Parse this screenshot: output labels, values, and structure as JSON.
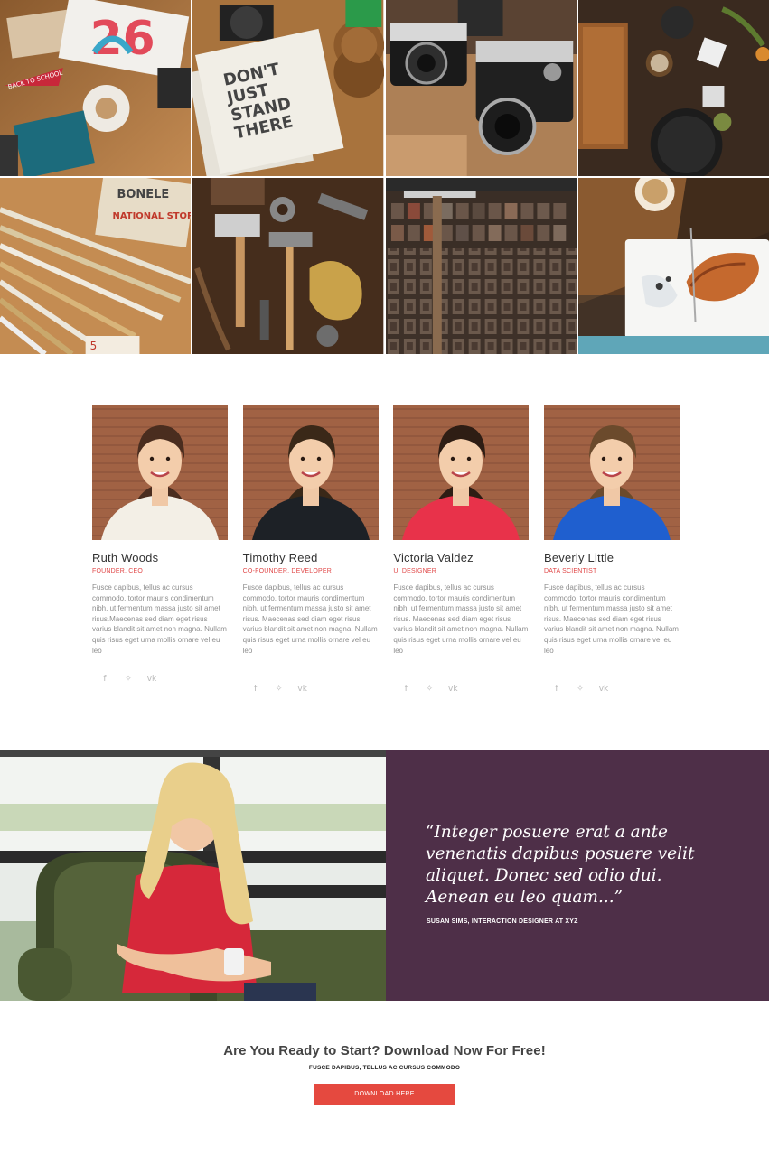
{
  "gallery": {
    "tiles": [
      {
        "icon": "stationery-photo",
        "text": ""
      },
      {
        "icon": "notebook-photo",
        "text": "DON'T JUST STAND THERE"
      },
      {
        "icon": "cameras-photo",
        "text": ""
      },
      {
        "icon": "kitchen-photo",
        "text": ""
      },
      {
        "icon": "rulers-photo",
        "text": "BONELE NATIONAL STOR"
      },
      {
        "icon": "tools-photo",
        "text": ""
      },
      {
        "icon": "letterpress-photo",
        "text": ""
      },
      {
        "icon": "food-plate-photo",
        "text": ""
      }
    ]
  },
  "team": {
    "members": [
      {
        "name": "Ruth Woods",
        "role": "FOUNDER, CEO",
        "bio": "Fusce dapibus, tellus ac cursus commodo, tortor mauris condimentum nibh, ut fermentum massa justo sit amet risus.Maecenas sed diam eget risus varius blandit sit amet non magna. Nullam quis risus eget urna mollis ornare vel eu leo",
        "shirt_color": "#f3efe6",
        "hair_color": "#4a2d1f"
      },
      {
        "name": "Timothy Reed",
        "role": "CO-FOUNDER, DEVELOPER",
        "bio": "Fusce dapibus, tellus ac cursus commodo, tortor mauris condimentum nibh, ut fermentum massa justo sit amet risus. Maecenas sed diam eget risus varius blandit sit amet non magna. Nullam quis risus eget urna mollis ornare vel eu leo",
        "shirt_color": "#1d2126",
        "hair_color": "#3a2818"
      },
      {
        "name": "Victoria Valdez",
        "role": "UI DESIGNER",
        "bio": "Fusce dapibus, tellus ac cursus commodo, tortor mauris condimentum nibh, ut fermentum massa justo sit amet risus. Maecenas sed diam eget risus varius blandit sit amet non magna. Nullam quis risus eget urna mollis ornare vel eu leo",
        "shirt_color": "#e8324a",
        "hair_color": "#2e1d14"
      },
      {
        "name": "Beverly Little",
        "role": "DATA SCIENTIST",
        "bio": "Fusce dapibus, tellus ac cursus commodo, tortor mauris condimentum nibh, ut fermentum massa justo sit amet risus. Maecenas sed diam eget risus varius blandit sit amet non magna. Nullam quis risus eget urna mollis ornare vel eu leo",
        "shirt_color": "#1f5fcf",
        "hair_color": "#6b4a2c"
      }
    ],
    "social_icons": [
      {
        "name": "facebook-icon",
        "glyph": "f"
      },
      {
        "name": "twitter-icon",
        "glyph": "❧"
      },
      {
        "name": "vk-icon",
        "glyph": "vk"
      }
    ]
  },
  "testimonial": {
    "quote": "“Integer posuere erat a ante venenatis dapibus posuere velit aliquet. Donec sed odio dui. Aenean eu leo quam...”",
    "author": "SUSAN SIMS, INTERACTION DESIGNER AT XYZ",
    "panel_color": "#4e2f48"
  },
  "cta": {
    "title": "Are You Ready to Start? Download Now For Free!",
    "subtitle": "FUSCE DAPIBUS, TELLUS AC CURSUS COMMODO",
    "button_label": "DOWNLOAD HERE",
    "button_color": "#e5493f"
  }
}
